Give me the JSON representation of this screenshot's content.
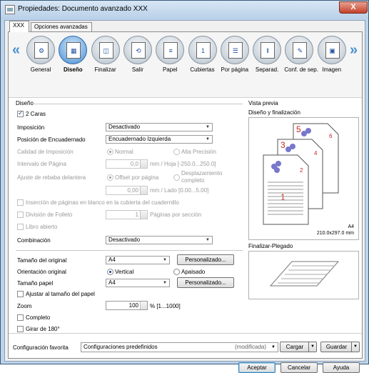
{
  "window": {
    "title": "Propiedades: Documento avanzado XXX",
    "close_label": "X"
  },
  "tabs": [
    "XXX",
    "Opciones avanzadas"
  ],
  "categories": [
    {
      "label": "General",
      "icon": "general-icon"
    },
    {
      "label": "Diseño",
      "icon": "layout-icon",
      "selected": true
    },
    {
      "label": "Finalizar",
      "icon": "finish-icon"
    },
    {
      "label": "Salir",
      "icon": "output-icon"
    },
    {
      "label": "Papel",
      "icon": "paper-icon"
    },
    {
      "label": "Cubiertas",
      "icon": "covers-icon"
    },
    {
      "label": "Por página",
      "icon": "per-page-icon"
    },
    {
      "label": "Separad.",
      "icon": "separator-icon"
    },
    {
      "label": "Conf. de sep.",
      "icon": "separator-config-icon"
    },
    {
      "label": "Imagen",
      "icon": "image-icon"
    }
  ],
  "layout": {
    "section": "Diseño",
    "two_sided": "2 Caras",
    "imposition_label": "Imposición",
    "imposition_value": "Desactivado",
    "binding_label": "Posición de Encuadernado",
    "binding_value": "Encuadernado Izquierda",
    "quality_label": "Calidad de Imposición",
    "quality_normal": "Normal",
    "quality_high": "Alta Precisión",
    "interval_label": "Intervalo de Página",
    "interval_value": "0,0",
    "interval_unit": "mm / Hoja [-250.0...250.0]",
    "trim_label": "Ajuste de rebaba delantera",
    "trim_offset": "Offset por página",
    "trim_shift": "Desplazamiento completo",
    "trim_value": "0,00",
    "trim_unit": "mm / Lado [0.00...5.00]",
    "blank_insert": "Inserción de páginas en blanco en la cubierta del cuadernillo",
    "booklet_split": "División de Folleto",
    "booklet_value": "1",
    "booklet_unit": "Páginas por sección",
    "open_book": "Libro abierto",
    "combination_label": "Combinación",
    "combination_value": "Desactivado",
    "original_size_label": "Tamaño del original",
    "original_size_value": "A4",
    "custom_button": "Personalizado...",
    "orientation_label": "Orientación original",
    "orientation_vertical": "Vertical",
    "orientation_landscape": "Apaisado",
    "paper_size_label": "Tamaño papel",
    "paper_size_value": "A4",
    "fit_paper": "Ajustar al tamaño del papel",
    "zoom_label": "Zoom",
    "zoom_value": "100",
    "zoom_unit": "% [1...1000]",
    "complete": "Completo",
    "rotate": "Girar de 180°"
  },
  "preview": {
    "title": "Vista previa",
    "design_label": "Diseño y finalización",
    "paper": "A4",
    "paper_dims": "210.0x297.0 mm",
    "fold_label": "Finalizar-Plegado"
  },
  "footer": {
    "fav_label": "Configuración favorita",
    "fav_value": "Configuraciones predefinidos",
    "fav_modified": "(modificada)",
    "load": "Cargar",
    "save": "Guardar",
    "ok": "Aceptar",
    "cancel": "Cancelar",
    "help": "Ayuda"
  }
}
